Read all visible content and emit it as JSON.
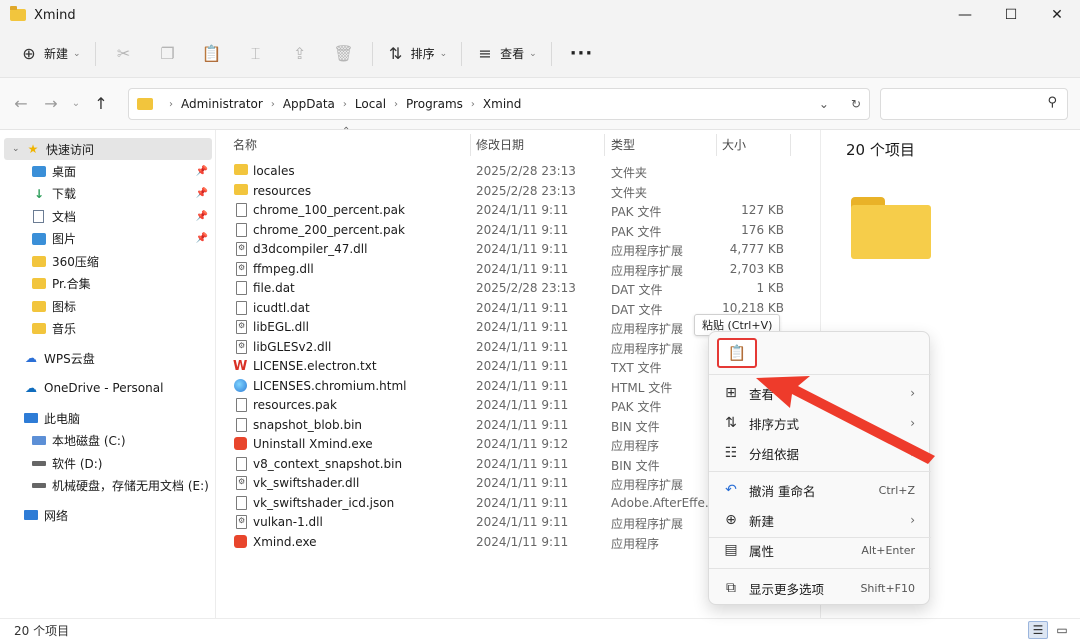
{
  "window": {
    "title": "Xmind",
    "minimize": "—",
    "maximize": "☐",
    "close": "✕"
  },
  "toolbar": {
    "new_label": "新建",
    "sort_label": "排序",
    "view_label": "查看",
    "more": "···"
  },
  "address": {
    "crumbs": [
      "Administrator",
      "AppData",
      "Local",
      "Programs",
      "Xmind"
    ],
    "search_placeholder": ""
  },
  "sidebar": {
    "quick_access": "快速访问",
    "pinned": [
      "桌面",
      "下载",
      "文档",
      "图片"
    ],
    "folders": [
      "360压缩",
      "Pr.合集",
      "图标",
      "音乐"
    ],
    "wps": "WPS云盘",
    "onedrive": "OneDrive - Personal",
    "this_pc": "此电脑",
    "drives": [
      "本地磁盘 (C:)",
      "软件 (D:)",
      "机械硬盘，存储无用文档 (E:)"
    ],
    "network": "网络"
  },
  "columns": {
    "name": "名称",
    "date": "修改日期",
    "type": "类型",
    "size": "大小"
  },
  "files": [
    {
      "name": "locales",
      "date": "2025/2/28 23:13",
      "type": "文件夹",
      "size": "",
      "icon": "folder"
    },
    {
      "name": "resources",
      "date": "2025/2/28 23:13",
      "type": "文件夹",
      "size": "",
      "icon": "folder"
    },
    {
      "name": "chrome_100_percent.pak",
      "date": "2024/1/11 9:11",
      "type": "PAK 文件",
      "size": "127 KB",
      "icon": "file"
    },
    {
      "name": "chrome_200_percent.pak",
      "date": "2024/1/11 9:11",
      "type": "PAK 文件",
      "size": "176 KB",
      "icon": "file"
    },
    {
      "name": "d3dcompiler_47.dll",
      "date": "2024/1/11 9:11",
      "type": "应用程序扩展",
      "size": "4,777 KB",
      "icon": "dll"
    },
    {
      "name": "ffmpeg.dll",
      "date": "2024/1/11 9:11",
      "type": "应用程序扩展",
      "size": "2,703 KB",
      "icon": "dll"
    },
    {
      "name": "file.dat",
      "date": "2025/2/28 23:13",
      "type": "DAT 文件",
      "size": "1 KB",
      "icon": "file"
    },
    {
      "name": "icudtl.dat",
      "date": "2024/1/11 9:11",
      "type": "DAT 文件",
      "size": "10,218 KB",
      "icon": "file"
    },
    {
      "name": "libEGL.dll",
      "date": "2024/1/11 9:11",
      "type": "应用程序扩展",
      "size": "",
      "icon": "dll"
    },
    {
      "name": "libGLESv2.dll",
      "date": "2024/1/11 9:11",
      "type": "应用程序扩展",
      "size": "",
      "icon": "dll"
    },
    {
      "name": "LICENSE.electron.txt",
      "date": "2024/1/11 9:11",
      "type": "TXT 文件",
      "size": "",
      "icon": "wps"
    },
    {
      "name": "LICENSES.chromium.html",
      "date": "2024/1/11 9:11",
      "type": "HTML 文件",
      "size": "",
      "icon": "edge"
    },
    {
      "name": "resources.pak",
      "date": "2024/1/11 9:11",
      "type": "PAK 文件",
      "size": "",
      "icon": "file"
    },
    {
      "name": "snapshot_blob.bin",
      "date": "2024/1/11 9:11",
      "type": "BIN 文件",
      "size": "",
      "icon": "file"
    },
    {
      "name": "Uninstall Xmind.exe",
      "date": "2024/1/11 9:12",
      "type": "应用程序",
      "size": "",
      "icon": "xmind"
    },
    {
      "name": "v8_context_snapshot.bin",
      "date": "2024/1/11 9:11",
      "type": "BIN 文件",
      "size": "",
      "icon": "file"
    },
    {
      "name": "vk_swiftshader.dll",
      "date": "2024/1/11 9:11",
      "type": "应用程序扩展",
      "size": "",
      "icon": "dll"
    },
    {
      "name": "vk_swiftshader_icd.json",
      "date": "2024/1/11 9:11",
      "type": "Adobe.AfterEffe...",
      "size": "",
      "icon": "file"
    },
    {
      "name": "vulkan-1.dll",
      "date": "2024/1/11 9:11",
      "type": "应用程序扩展",
      "size": "",
      "icon": "dll"
    },
    {
      "name": "Xmind.exe",
      "date": "2024/1/11 9:11",
      "type": "应用程序",
      "size": "",
      "icon": "xmind"
    }
  ],
  "details": {
    "count": "20 个项目"
  },
  "status": {
    "count": "20 个项目"
  },
  "tooltip": "粘贴 (Ctrl+V)",
  "context_menu": {
    "view": "查看",
    "sort": "排序方式",
    "group": "分组依据",
    "undo": "撤消 重命名",
    "undo_key": "Ctrl+Z",
    "new": "新建",
    "properties": "属性",
    "properties_key": "Alt+Enter",
    "more_options": "显示更多选项",
    "more_key": "Shift+F10"
  },
  "colors": {
    "accent": "#2b6fd6",
    "highlight": "#e53935",
    "folder": "#f2c53d"
  }
}
